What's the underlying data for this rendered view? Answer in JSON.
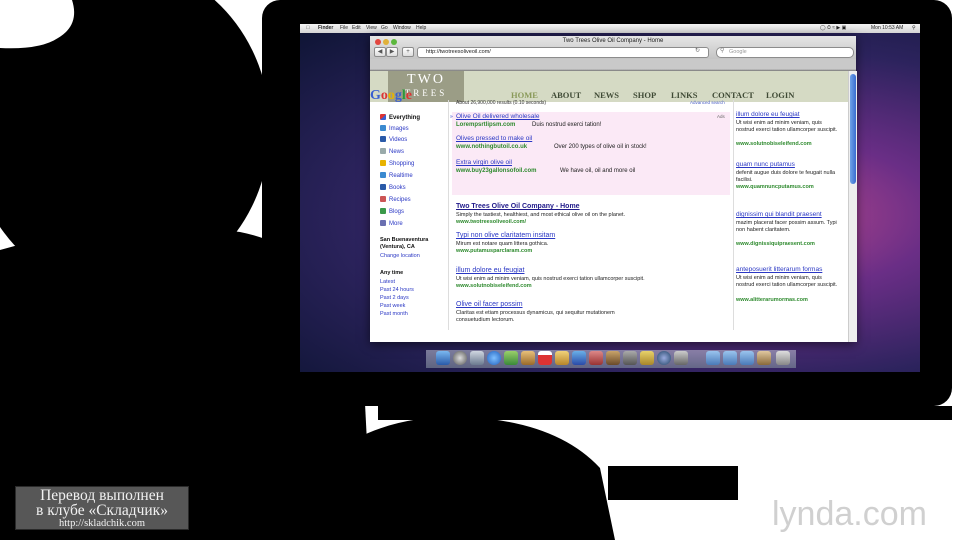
{
  "menubar": {
    "items": [
      "Finder",
      "File",
      "Edit",
      "View",
      "Go",
      "Window",
      "Help"
    ],
    "clock": "Mon 10:53 AM"
  },
  "browser": {
    "window_title": "Two Trees Olive Oil Company - Home",
    "url": "http://twotreesoliveoil.com/",
    "search_placeholder": "Google"
  },
  "site_header": {
    "logo_line1": "TWO",
    "logo_line2": "TREES",
    "google_logo": "Google",
    "nav": [
      "HOME",
      "ABOUT",
      "NEWS",
      "SHOP",
      "LINKS",
      "CONTACT",
      "LOGIN"
    ]
  },
  "google": {
    "result_count": "About 26,900,000 results (0.10 seconds)",
    "advanced_search": "Advanced search",
    "ads_label": "Ads",
    "left_nav": [
      "Everything",
      "Images",
      "Videos",
      "News",
      "Shopping",
      "Realtime",
      "Books",
      "Recipes",
      "Blogs",
      "More"
    ],
    "location_title": "San Buenaventura (Ventura), CA",
    "change_location": "Change location",
    "time_title": "Any time",
    "time_options": [
      "Latest",
      "Past 24 hours",
      "Past 2 days",
      "Past week",
      "Past month"
    ],
    "top_ads": [
      {
        "title": "Olive Oil delivered wholesale",
        "url": "Lorempsrtlipsm.com",
        "desc": "Duis nostrud exerci tation!"
      },
      {
        "title": "Olives pressed to make oil",
        "url": "www.nothingbutoil.co.uk",
        "desc": "Over 200 types of olive oil in stock!"
      },
      {
        "title": "Extra virgin olive oil",
        "url": "www.buy23gallonsofoil.com",
        "desc": "We have oil, oil and more oil"
      }
    ],
    "results": [
      {
        "title": "Two Trees Olive Oil Company - Home",
        "desc": "Simply the tastiest, healthiest, and most ethical olive oil on the planet.",
        "desc2": "",
        "url": "www.twotreesoliveoil.com/"
      },
      {
        "title": "Typi non olive claritatem insitam",
        "desc": "Mirum est notare quam littera gothica.",
        "desc2": "",
        "url": "www.putamusparclaram.com"
      },
      {
        "title": "illum dolore eu feugiat",
        "desc": "Ut wisi enim ad minim veniam, quis nostrud exerci tation ullamcorper suscipit.",
        "desc2": "",
        "url": "www.solutnobiseleifend.com"
      },
      {
        "title": "Olive oil facer possim",
        "desc": "Claritas est etiam processus dynamicus, qui sequitur mutationem",
        "desc2": "consuetudium lectorum.",
        "url": ""
      }
    ],
    "side_ads": [
      {
        "title": "illum dolore eu feugiat",
        "desc": "Ut wisi enim ad minim veniam, quis nostrud exerci tation ullamcorper suscipit.",
        "url": "www.solutnobiseleifend.com"
      },
      {
        "title": "quam nunc putamus",
        "desc": "defenit augue duis dolore te feugait nulla facilisi.",
        "url": "www.quamnuncputamus.com"
      },
      {
        "title": "dignissim qui blandit praesent",
        "desc": "mazim placerat facer possim assum. Typi non habent claritatem.",
        "url": "www.dignissiquipraesent.com"
      },
      {
        "title": "anteposuerit litterarum formas",
        "desc": "Ut wisi enim ad minim veniam, quis nostrud exerci tation ullamcorper suscipit.",
        "url": "www.alitterarumormas.com"
      }
    ]
  },
  "overlay": {
    "credit_line1": "Перевод выполнен",
    "credit_line2": "в клубе «Складчик»",
    "credit_line3": "http://skladchik.com",
    "watermark": "lynda.com"
  }
}
